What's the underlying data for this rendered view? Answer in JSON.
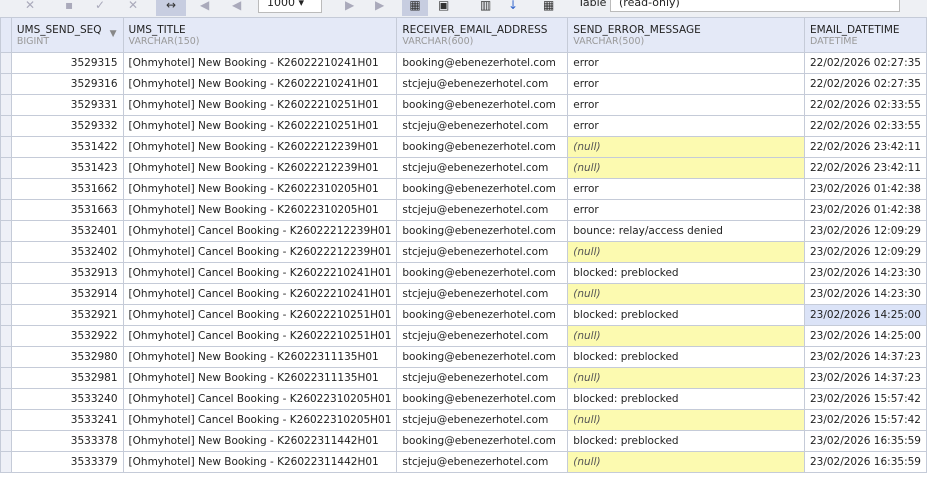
{
  "toolbar": {
    "limit": "1000",
    "table_label": "Table",
    "table_value": "(read-only)"
  },
  "columns": [
    {
      "name": "UMS_SEND_SEQ",
      "type": "BIGINT"
    },
    {
      "name": "UMS_TITLE",
      "type": "VARCHAR(150)"
    },
    {
      "name": "RECEIVER_EMAIL_ADDRESS",
      "type": "VARCHAR(600)"
    },
    {
      "name": "SEND_ERROR_MESSAGE",
      "type": "VARCHAR(500)"
    },
    {
      "name": "EMAIL_DATETIME",
      "type": "DATETIME"
    }
  ],
  "rows": [
    [
      "3529315",
      "[Ohmyhotel] New Booking - K26022210241H01",
      "booking@ebenezerhotel.com",
      "error",
      "22/02/2026 02:27:35"
    ],
    [
      "3529316",
      "[Ohmyhotel] New Booking - K26022210241H01",
      "stcjeju@ebenezerhotel.com",
      "error",
      "22/02/2026 02:27:35"
    ],
    [
      "3529331",
      "[Ohmyhotel] New Booking - K26022210251H01",
      "booking@ebenezerhotel.com",
      "error",
      "22/02/2026 02:33:55"
    ],
    [
      "3529332",
      "[Ohmyhotel] New Booking - K26022210251H01",
      "stcjeju@ebenezerhotel.com",
      "error",
      "22/02/2026 02:33:55"
    ],
    [
      "3531422",
      "[Ohmyhotel] New Booking - K26022212239H01",
      "booking@ebenezerhotel.com",
      "(null)",
      "22/02/2026 23:42:11"
    ],
    [
      "3531423",
      "[Ohmyhotel] New Booking - K26022212239H01",
      "stcjeju@ebenezerhotel.com",
      "(null)",
      "22/02/2026 23:42:11"
    ],
    [
      "3531662",
      "[Ohmyhotel] New Booking - K26022310205H01",
      "booking@ebenezerhotel.com",
      "error",
      "23/02/2026 01:42:38"
    ],
    [
      "3531663",
      "[Ohmyhotel] New Booking - K26022310205H01",
      "stcjeju@ebenezerhotel.com",
      "error",
      "23/02/2026 01:42:38"
    ],
    [
      "3532401",
      "[Ohmyhotel] Cancel Booking - K26022212239H01",
      "booking@ebenezerhotel.com",
      "bounce: relay/access denied",
      "23/02/2026 12:09:29"
    ],
    [
      "3532402",
      "[Ohmyhotel] Cancel Booking - K26022212239H01",
      "stcjeju@ebenezerhotel.com",
      "(null)",
      "23/02/2026 12:09:29"
    ],
    [
      "3532913",
      "[Ohmyhotel] Cancel Booking - K26022210241H01",
      "booking@ebenezerhotel.com",
      "blocked: preblocked",
      "23/02/2026 14:23:30"
    ],
    [
      "3532914",
      "[Ohmyhotel] Cancel Booking - K26022210241H01",
      "stcjeju@ebenezerhotel.com",
      "(null)",
      "23/02/2026 14:23:30"
    ],
    [
      "3532921",
      "[Ohmyhotel] Cancel Booking - K26022210251H01",
      "booking@ebenezerhotel.com",
      "blocked: preblocked",
      "23/02/2026 14:25:00"
    ],
    [
      "3532922",
      "[Ohmyhotel] Cancel Booking - K26022210251H01",
      "stcjeju@ebenezerhotel.com",
      "(null)",
      "23/02/2026 14:25:00"
    ],
    [
      "3532980",
      "[Ohmyhotel] New Booking - K26022311135H01",
      "booking@ebenezerhotel.com",
      "blocked: preblocked",
      "23/02/2026 14:37:23"
    ],
    [
      "3532981",
      "[Ohmyhotel] New Booking - K26022311135H01",
      "stcjeju@ebenezerhotel.com",
      "(null)",
      "23/02/2026 14:37:23"
    ],
    [
      "3533240",
      "[Ohmyhotel] Cancel Booking - K26022310205H01",
      "booking@ebenezerhotel.com",
      "blocked: preblocked",
      "23/02/2026 15:57:42"
    ],
    [
      "3533241",
      "[Ohmyhotel] Cancel Booking - K26022310205H01",
      "stcjeju@ebenezerhotel.com",
      "(null)",
      "23/02/2026 15:57:42"
    ],
    [
      "3533378",
      "[Ohmyhotel] New Booking - K26022311442H01",
      "booking@ebenezerhotel.com",
      "blocked: preblocked",
      "23/02/2026 16:35:59"
    ],
    [
      "3533379",
      "[Ohmyhotel] New Booking - K26022311442H01",
      "stcjeju@ebenezerhotel.com",
      "(null)",
      "23/02/2026 16:35:59"
    ]
  ],
  "selected_row": 12
}
